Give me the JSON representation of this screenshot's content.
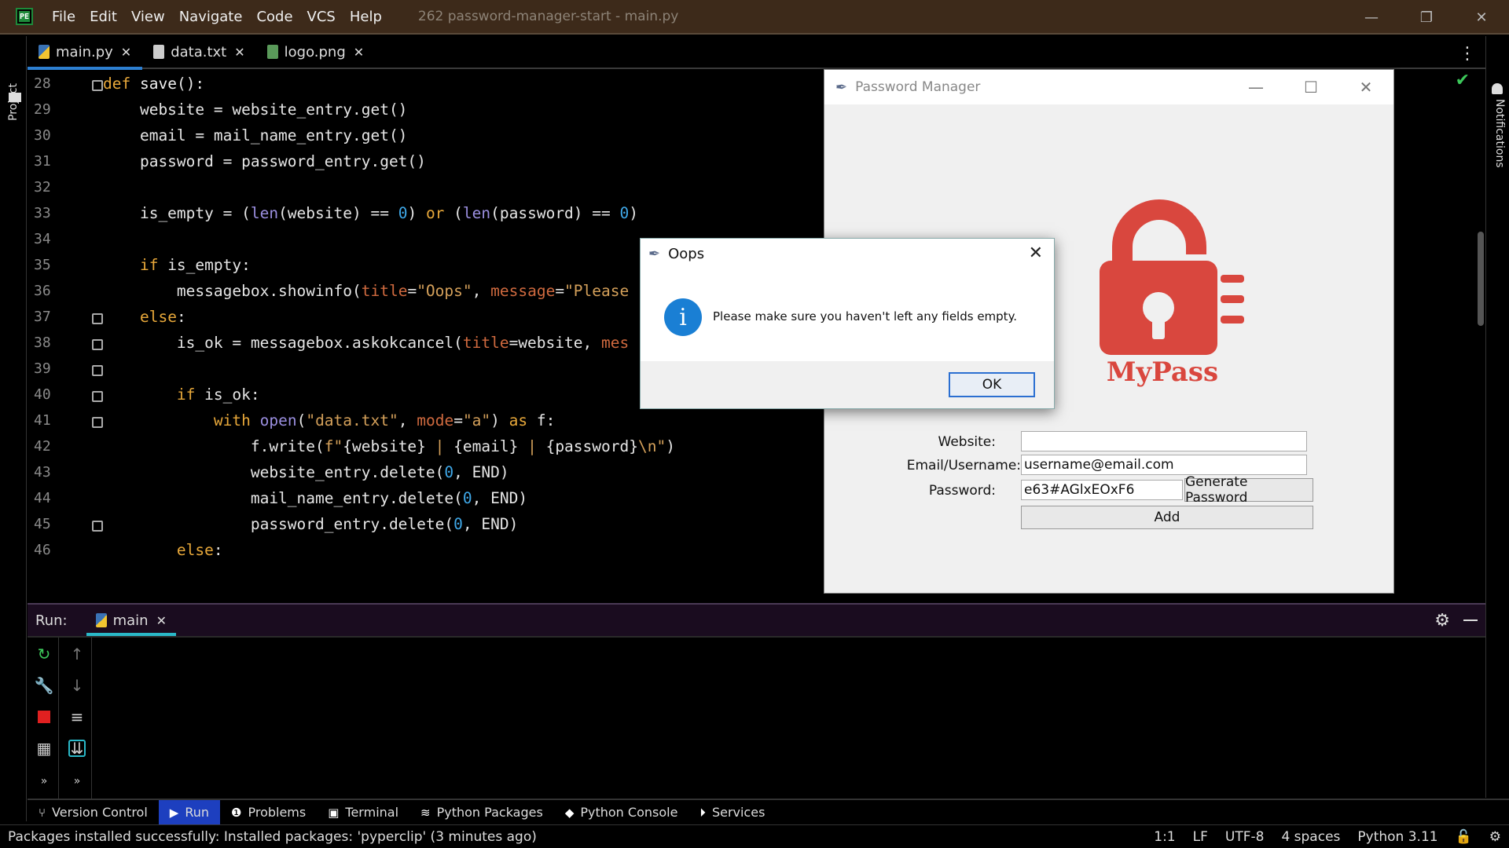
{
  "titlebar": {
    "logo": "PE",
    "menu": [
      "File",
      "Edit",
      "View",
      "Navigate",
      "Code",
      "VCS",
      "Help"
    ],
    "window_title": "262 password-manager-start - main.py",
    "controls": {
      "minimize": "—",
      "restore": "❐",
      "close": "✕"
    }
  },
  "left_stripe": {
    "project_label": "Project"
  },
  "right_stripe": {
    "notifications_label": "Notifications"
  },
  "tabs": [
    {
      "label": "main.py",
      "icon": "python-file-icon",
      "active": true
    },
    {
      "label": "data.txt",
      "icon": "text-file-icon",
      "active": false
    },
    {
      "label": "logo.png",
      "icon": "image-file-icon",
      "active": false
    }
  ],
  "tab_close": "✕",
  "editor": {
    "line_numbers": [
      "28",
      "29",
      "30",
      "31",
      "32",
      "33",
      "34",
      "35",
      "36",
      "37",
      "38",
      "39",
      "40",
      "41",
      "42",
      "43",
      "44",
      "45",
      "46"
    ]
  },
  "run": {
    "label": "Run:",
    "tab_label": "main",
    "tab_close": "✕"
  },
  "tool_bar": [
    {
      "label": "Version Control",
      "icon": "vcs-branch-icon"
    },
    {
      "label": "Run",
      "icon": "run-play-icon",
      "active": true
    },
    {
      "label": "Problems",
      "icon": "problems-icon"
    },
    {
      "label": "Terminal",
      "icon": "terminal-icon"
    },
    {
      "label": "Python Packages",
      "icon": "packages-layers-icon"
    },
    {
      "label": "Python Console",
      "icon": "python-console-icon"
    },
    {
      "label": "Services",
      "icon": "services-play-icon"
    }
  ],
  "status_bar": {
    "message": "Packages installed successfully: Installed packages: 'pyperclip' (3 minutes ago)",
    "position": "1:1",
    "line_sep": "LF",
    "encoding": "UTF-8",
    "indent": "4 spaces",
    "interpreter": "Python 3.11"
  },
  "password_manager": {
    "title": "Password Manager",
    "logo_text": "MyPass",
    "website_label": "Website:",
    "website_value": "",
    "email_label": "Email/Username:",
    "email_value": "username@email.com",
    "password_label": "Password:",
    "password_value": "e63#AGlxEOxF6",
    "generate_button": "Generate Password",
    "add_button": "Add"
  },
  "dialog": {
    "title": "Oops",
    "message": "Please make sure you haven't left any fields empty.",
    "ok_button": "OK",
    "info_symbol": "i"
  }
}
